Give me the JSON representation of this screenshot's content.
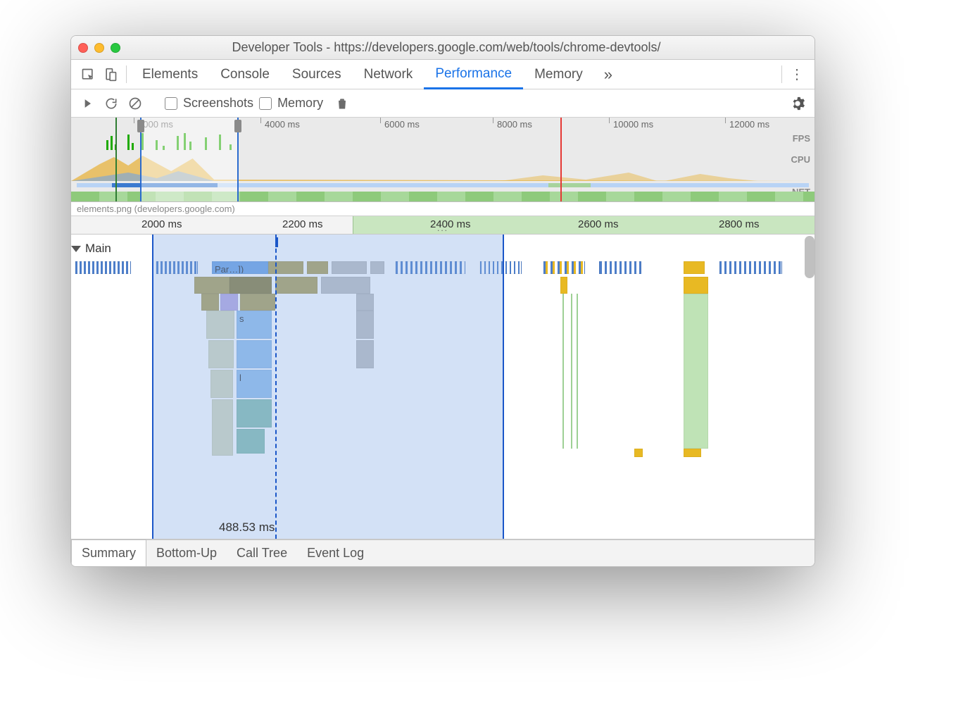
{
  "window": {
    "title": "Developer Tools - https://developers.google.com/web/tools/chrome-devtools/"
  },
  "tabs": {
    "elements": "Elements",
    "console": "Console",
    "sources": "Sources",
    "network": "Network",
    "performance": "Performance",
    "memory": "Memory",
    "more": "»"
  },
  "toolbar": {
    "screenshots": "Screenshots",
    "memory": "Memory"
  },
  "overview": {
    "ticks": [
      "2000 ms",
      "4000 ms",
      "6000 ms",
      "8000 ms",
      "10000 ms",
      "12000 ms"
    ],
    "labels": {
      "fps": "FPS",
      "cpu": "CPU",
      "net": "NET"
    },
    "info": "elements.png (developers.google.com)"
  },
  "ruler": {
    "ticks": [
      "2000 ms",
      "2200 ms",
      "2400 ms",
      "2600 ms",
      "2800 ms"
    ]
  },
  "flame": {
    "main_label": "Main",
    "block_par": "Par…])",
    "block_s": "s",
    "block_l": "l",
    "selection_time": "488.53 ms"
  },
  "bottom_tabs": {
    "summary": "Summary",
    "bottom_up": "Bottom-Up",
    "call_tree": "Call Tree",
    "event_log": "Event Log"
  }
}
